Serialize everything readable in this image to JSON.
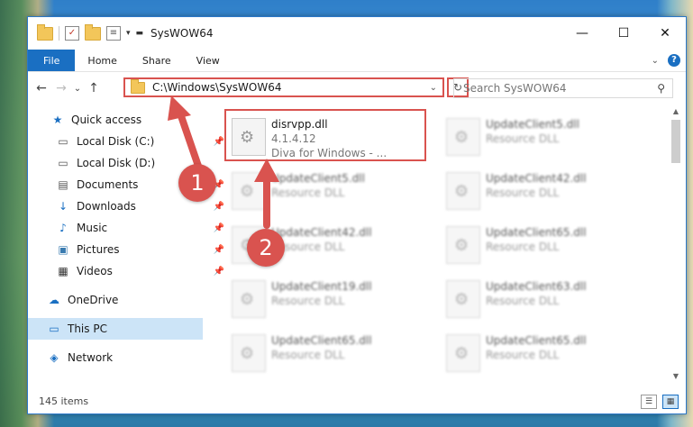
{
  "window": {
    "title": "SysWOW64",
    "controls": {
      "minimize": "—",
      "maximize": "☐",
      "close": "✕"
    }
  },
  "ribbon": {
    "tabs": [
      "File",
      "Home",
      "Share",
      "View"
    ],
    "expand": "⌄",
    "help": "?"
  },
  "nav": {
    "back": "←",
    "forward": "→",
    "recent": "⌄",
    "up": "↑"
  },
  "address": {
    "path": "C:\\Windows\\SysWOW64",
    "dropdown": "⌄",
    "refresh": "↻"
  },
  "search": {
    "placeholder": "Search SysWOW64",
    "icon": "⚲"
  },
  "sidebar": {
    "items": [
      {
        "label": "Quick access",
        "icon": "star-icon",
        "glyph": "★"
      },
      {
        "label": "Local Disk (C:)",
        "icon": "drive-icon",
        "glyph": "▭",
        "pinned": true
      },
      {
        "label": "Local Disk (D:)",
        "icon": "drive-icon",
        "glyph": "▭"
      },
      {
        "label": "Documents",
        "icon": "documents-icon",
        "glyph": "▤",
        "pinned": true
      },
      {
        "label": "Downloads",
        "icon": "downloads-icon",
        "glyph": "↓",
        "pinned": true
      },
      {
        "label": "Music",
        "icon": "music-icon",
        "glyph": "♪",
        "pinned": true
      },
      {
        "label": "Pictures",
        "icon": "pictures-icon",
        "glyph": "▣",
        "pinned": true
      },
      {
        "label": "Videos",
        "icon": "videos-icon",
        "glyph": "▦",
        "pinned": true
      },
      {
        "label": "OneDrive",
        "icon": "onedrive-icon",
        "glyph": "☁"
      },
      {
        "label": "This PC",
        "icon": "this-pc-icon",
        "glyph": "▭"
      },
      {
        "label": "Network",
        "icon": "network-icon",
        "glyph": "◈"
      }
    ],
    "pin_glyph": "📌"
  },
  "files": [
    {
      "name": "disrvpp.dll",
      "line2": "4.1.4.12",
      "line3": "Diva for Windows - ..."
    },
    {
      "name": "UpdateClient5.dll",
      "line2": "Resource DLL"
    },
    {
      "name": "UpdateClient5.dll",
      "line2": "Resource DLL"
    },
    {
      "name": "UpdateClient42.dll",
      "line2": "Resource DLL"
    },
    {
      "name": "UpdateClient42.dll",
      "line2": "Resource DLL"
    },
    {
      "name": "UpdateClient65.dll",
      "line2": "Resource DLL"
    },
    {
      "name": "UpdateClient19.dll",
      "line2": "Resource DLL"
    },
    {
      "name": "UpdateClient63.dll",
      "line2": "Resource DLL"
    },
    {
      "name": "UpdateClient65.dll",
      "line2": "Resource DLL"
    },
    {
      "name": "UpdateClient65.dll",
      "line2": "Resource DLL"
    }
  ],
  "status": {
    "item_count": "145 items"
  },
  "annotations": {
    "badge1": "1",
    "badge2": "2"
  },
  "colors": {
    "accent": "#1a6fc2",
    "highlight": "#d9534f",
    "selected": "#cce4f7"
  }
}
